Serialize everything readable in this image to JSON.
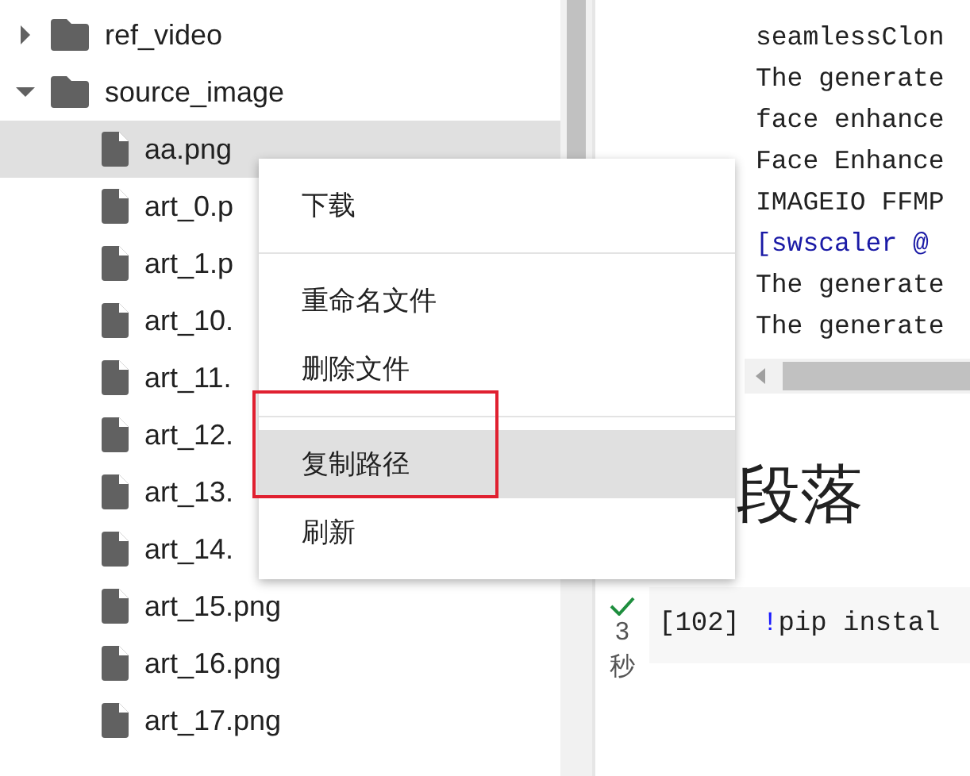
{
  "file_tree": [
    {
      "name": "ref_video",
      "kind": "folder",
      "expanded": false,
      "selected": false
    },
    {
      "name": "source_image",
      "kind": "folder",
      "expanded": true,
      "selected": false,
      "children": [
        {
          "name": "aa.png",
          "kind": "file",
          "selected": true
        },
        {
          "name": "art_0.p",
          "kind": "file",
          "selected": false
        },
        {
          "name": "art_1.p",
          "kind": "file",
          "selected": false
        },
        {
          "name": "art_10.",
          "kind": "file",
          "selected": false
        },
        {
          "name": "art_11.",
          "kind": "file",
          "selected": false
        },
        {
          "name": "art_12.",
          "kind": "file",
          "selected": false
        },
        {
          "name": "art_13.",
          "kind": "file",
          "selected": false
        },
        {
          "name": "art_14.",
          "kind": "file",
          "selected": false
        },
        {
          "name": "art_15.png",
          "kind": "file",
          "selected": false
        },
        {
          "name": "art_16.png",
          "kind": "file",
          "selected": false
        },
        {
          "name": "art_17.png",
          "kind": "file",
          "selected": false
        }
      ]
    }
  ],
  "context_menu": {
    "groups": [
      [
        {
          "label": "下载",
          "highlighted": false,
          "outlined": false
        }
      ],
      [
        {
          "label": "重命名文件",
          "highlighted": false,
          "outlined": false
        },
        {
          "label": "删除文件",
          "highlighted": false,
          "outlined": false
        }
      ],
      [
        {
          "label": "复制路径",
          "highlighted": true,
          "outlined": true
        },
        {
          "label": "刷新",
          "highlighted": false,
          "outlined": false
        }
      ]
    ]
  },
  "output": {
    "lines": [
      {
        "text": "seamlessClon",
        "kind": "plain"
      },
      {
        "text": "The generate",
        "kind": "plain"
      },
      {
        "text": "face enhance",
        "kind": "plain"
      },
      {
        "text": "Face Enhance",
        "kind": "plain"
      },
      {
        "text": "IMAGEIO FFMP",
        "kind": "plain"
      },
      {
        "text": "[swscaler @",
        "kind": "log"
      },
      {
        "text": "The generate",
        "kind": "plain"
      },
      {
        "text": "The generate",
        "kind": "plain"
      }
    ]
  },
  "heading": "段落",
  "code_cell": {
    "succeeded": true,
    "duration": [
      "3",
      "秒"
    ],
    "execution_count": "[102]",
    "code": [
      {
        "text": "!",
        "kind": "operator"
      },
      {
        "text": "pip  instal",
        "kind": "plain"
      }
    ]
  }
}
